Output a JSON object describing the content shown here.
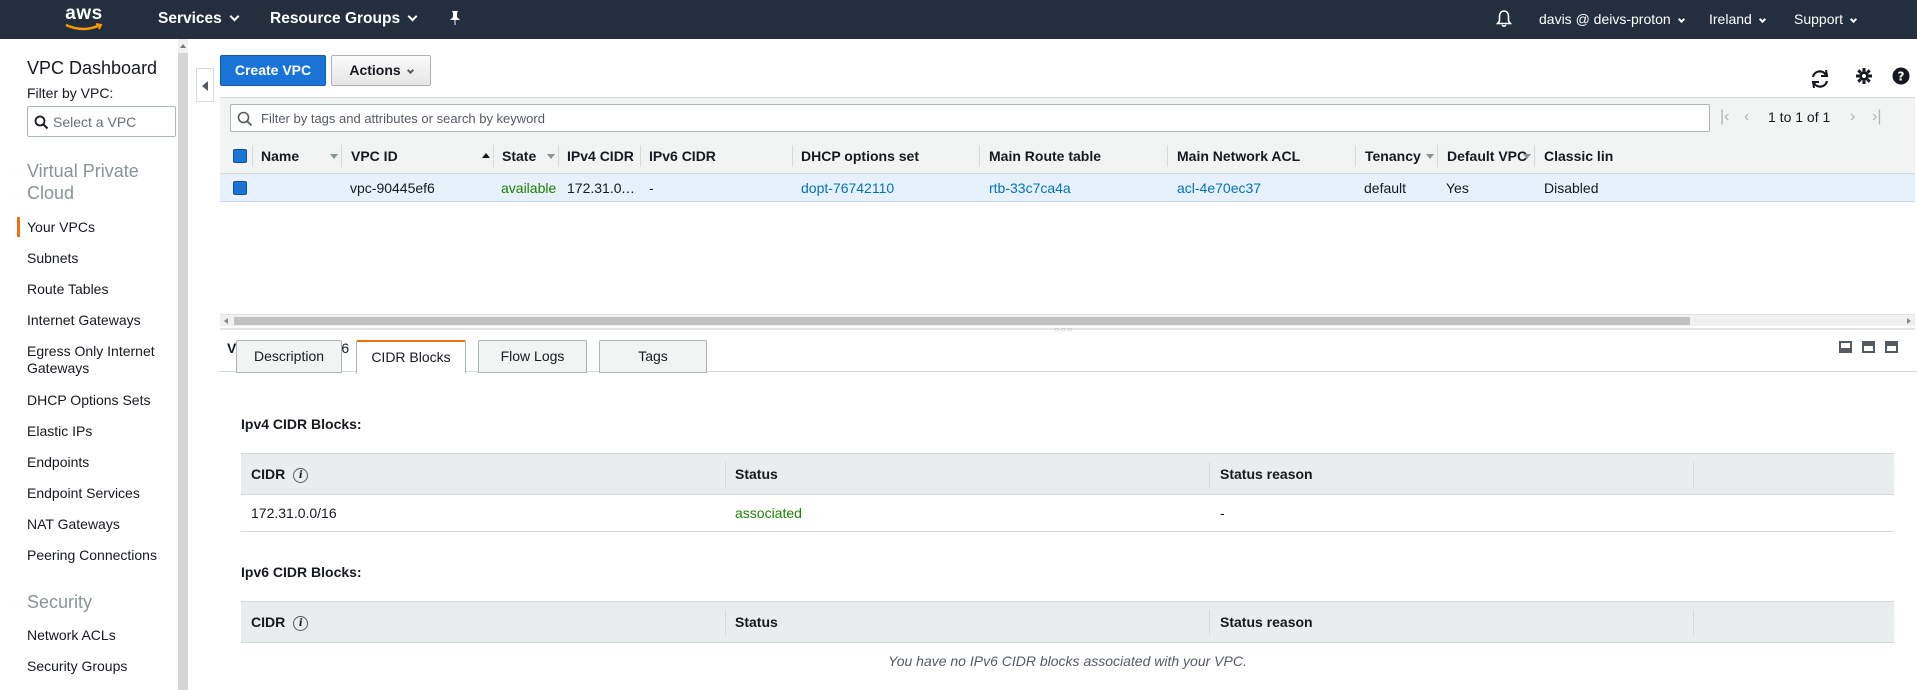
{
  "topbar": {
    "logo_text": "aws",
    "services": "Services",
    "resource_groups": "Resource Groups",
    "account": "davis @ deivs-proton",
    "region": "Ireland",
    "support": "Support",
    "icons": [
      "pin-icon",
      "bell-icon"
    ]
  },
  "sidebar": {
    "title": "VPC Dashboard",
    "filter_label": "Filter by VPC:",
    "filter_placeholder": "Select a VPC",
    "section_vpc": "Virtual Private Cloud",
    "items": [
      "Your VPCs",
      "Subnets",
      "Route Tables",
      "Internet Gateways",
      "Egress Only Internet Gateways",
      "DHCP Options Sets",
      "Elastic IPs",
      "Endpoints",
      "Endpoint Services",
      "NAT Gateways",
      "Peering Connections"
    ],
    "active_item": "Your VPCs",
    "section_security": "Security",
    "security_items": [
      "Network ACLs",
      "Security Groups"
    ]
  },
  "actions": {
    "create_vpc": "Create VPC",
    "actions": "Actions"
  },
  "search": {
    "placeholder": "Filter by tags and attributes or search by keyword"
  },
  "pager": {
    "text": "1 to 1 of 1"
  },
  "grid": {
    "columns": [
      "Name",
      "VPC ID",
      "State",
      "IPv4 CIDR",
      "IPv6 CIDR",
      "DHCP options set",
      "Main Route table",
      "Main Network ACL",
      "Tenancy",
      "Default VPC",
      "Classic lin"
    ],
    "rows": [
      {
        "name": "",
        "vpc_id": "vpc-90445ef6",
        "state": "available",
        "ipv4_cidr": "172.31.0.….",
        "ipv6_cidr": "-",
        "dhcp_options_set": "dopt-76742110",
        "main_route_table": "rtb-33c7ca4a",
        "main_network_acl": "acl-4e70ec37",
        "tenancy": "default",
        "default_vpc": "Yes",
        "classic_link": "Disabled"
      }
    ]
  },
  "detail": {
    "label": "VPC:",
    "vpc_id": "vpc-90445ef6",
    "tabs": [
      "Description",
      "CIDR Blocks",
      "Flow Logs",
      "Tags"
    ],
    "active_tab": "CIDR Blocks",
    "ipv4_title": "Ipv4 CIDR Blocks:",
    "ipv6_title": "Ipv6 CIDR Blocks:",
    "table_columns": [
      "CIDR",
      "Status",
      "Status reason"
    ],
    "ipv4_rows": [
      {
        "cidr": "172.31.0.0/16",
        "status": "associated",
        "status_reason": "-"
      }
    ],
    "ipv6_empty": "You have no IPv6 CIDR blocks associated with your VPC."
  },
  "colors": {
    "topbar": "#232f3e",
    "primary_button": "#1a73d6",
    "link": "#0073bb",
    "status_green": "#1d8102",
    "active_accent": "#ec7211",
    "row_selected": "#e7f1fb"
  }
}
